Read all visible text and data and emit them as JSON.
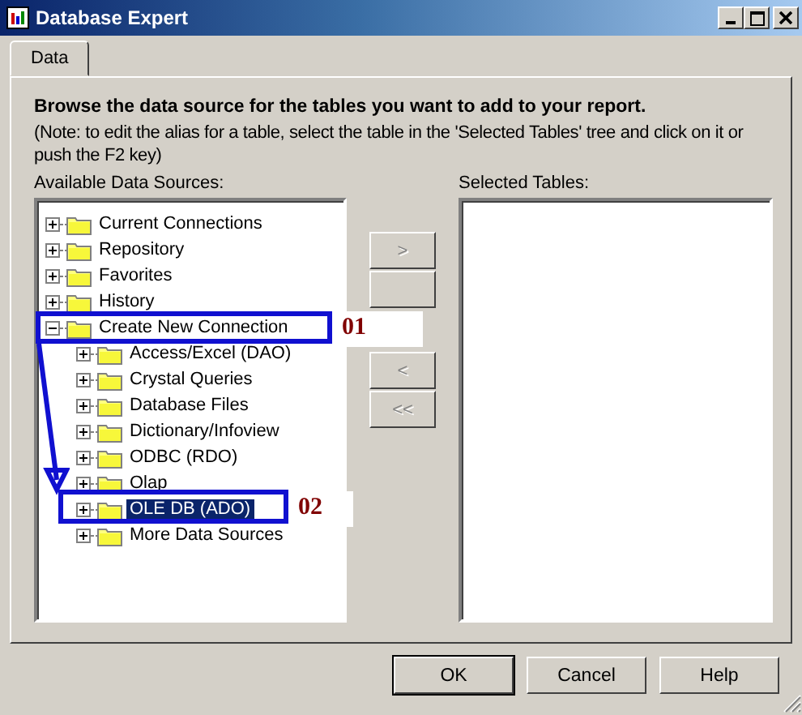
{
  "window": {
    "title": "Database Expert"
  },
  "tabs": [
    {
      "label": "Data",
      "selected": true
    }
  ],
  "heading": "Browse the data source for the tables you want to add to your report.",
  "note": "(Note: to edit the alias for a table, select the table in the 'Selected Tables' tree and click on it or push the F2 key)",
  "available": {
    "label": "Available Data Sources:",
    "tree": [
      {
        "label": "Current Connections",
        "expanded": false,
        "selected": false
      },
      {
        "label": "Repository",
        "expanded": false,
        "selected": false
      },
      {
        "label": "Favorites",
        "expanded": false,
        "selected": false
      },
      {
        "label": "History",
        "expanded": false,
        "selected": false
      },
      {
        "label": "Create New Connection",
        "expanded": true,
        "selected": false,
        "children": [
          {
            "label": "Access/Excel (DAO)",
            "expanded": false,
            "selected": false
          },
          {
            "label": "Crystal Queries",
            "expanded": false,
            "selected": false
          },
          {
            "label": "Database Files",
            "expanded": false,
            "selected": false
          },
          {
            "label": "Dictionary/Infoview",
            "expanded": false,
            "selected": false
          },
          {
            "label": "ODBC (RDO)",
            "expanded": false,
            "selected": false
          },
          {
            "label": "Olap",
            "expanded": false,
            "selected": false
          },
          {
            "label": "OLE DB (ADO)",
            "expanded": false,
            "selected": true
          },
          {
            "label": "More Data Sources",
            "expanded": false,
            "selected": false
          }
        ]
      }
    ]
  },
  "transfer_buttons": [
    {
      "kind": "text",
      "label": ">",
      "disabled": true
    },
    {
      "kind": "covered"
    },
    {
      "kind": "text",
      "label": "<",
      "disabled": true
    },
    {
      "kind": "text",
      "label": "<<",
      "disabled": true
    }
  ],
  "selected_tables": {
    "label": "Selected Tables:"
  },
  "buttons": [
    {
      "label": "OK",
      "default": true
    },
    {
      "label": "Cancel",
      "default": false
    },
    {
      "label": "Help",
      "default": false
    }
  ],
  "callouts": [
    {
      "label": "01"
    },
    {
      "label": "02"
    }
  ]
}
